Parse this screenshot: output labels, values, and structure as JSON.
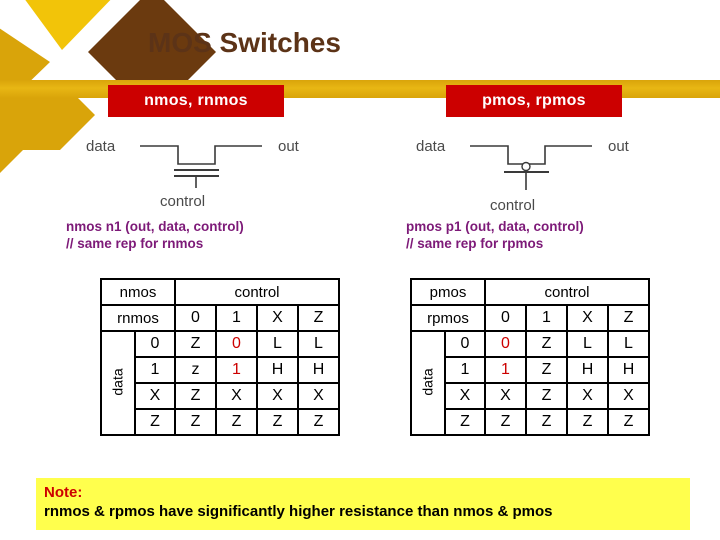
{
  "slide": {
    "title": "MOS Switches",
    "title_color": "#5c3317",
    "background": "#ffffff"
  },
  "theme": {
    "accent_red": "#cc0000",
    "accent_gold": "#d9a40a",
    "accent_yellow": "#f2c409",
    "accent_brown": "#6b3a0f",
    "accent_purple": "#7d1a78",
    "note_bg": "#ffff4d"
  },
  "sections": {
    "left": {
      "label": "nmos, rnmos",
      "symbol": {
        "data_label": "data",
        "out_label": "out",
        "control_label": "control",
        "has_bubble": false
      },
      "verilog_line1": "nmos n1 (out, data, control)",
      "verilog_line2": "// same rep for rnmos"
    },
    "right": {
      "label": "pmos, rpmos",
      "symbol": {
        "data_label": "data",
        "out_label": "out",
        "control_label": "control",
        "has_bubble": true
      },
      "verilog_line1": "pmos p1 (out, data, control)",
      "verilog_line2": "// same rep for rpmos"
    }
  },
  "tables": {
    "nmos": {
      "corner_name_top": "nmos",
      "corner_name_bottom": "rnmos",
      "control_header": "control",
      "control_values": [
        "0",
        "1",
        "X",
        "Z"
      ],
      "row_axis_label": "data",
      "row_values": [
        "0",
        "1",
        "X",
        "Z"
      ],
      "cells": [
        [
          "Z",
          "0",
          "L",
          "L"
        ],
        [
          "z",
          "1",
          "H",
          "H"
        ],
        [
          "Z",
          "X",
          "X",
          "X"
        ],
        [
          "Z",
          "Z",
          "Z",
          "Z"
        ]
      ],
      "highlight": [
        [
          0,
          1
        ],
        [
          1,
          1
        ]
      ]
    },
    "pmos": {
      "corner_name_top": "pmos",
      "corner_name_bottom": "rpmos",
      "control_header": "control",
      "control_values": [
        "0",
        "1",
        "X",
        "Z"
      ],
      "row_axis_label": "data",
      "row_values": [
        "0",
        "1",
        "X",
        "Z"
      ],
      "cells": [
        [
          "0",
          "Z",
          "L",
          "L"
        ],
        [
          "1",
          "Z",
          "H",
          "H"
        ],
        [
          "X",
          "Z",
          "X",
          "X"
        ],
        [
          "Z",
          "Z",
          "Z",
          "Z"
        ]
      ],
      "highlight": [
        [
          0,
          0
        ],
        [
          1,
          0
        ]
      ]
    }
  },
  "note": {
    "title": "Note:",
    "body": "rnmos & rpmos have significantly higher resistance than nmos & pmos"
  }
}
